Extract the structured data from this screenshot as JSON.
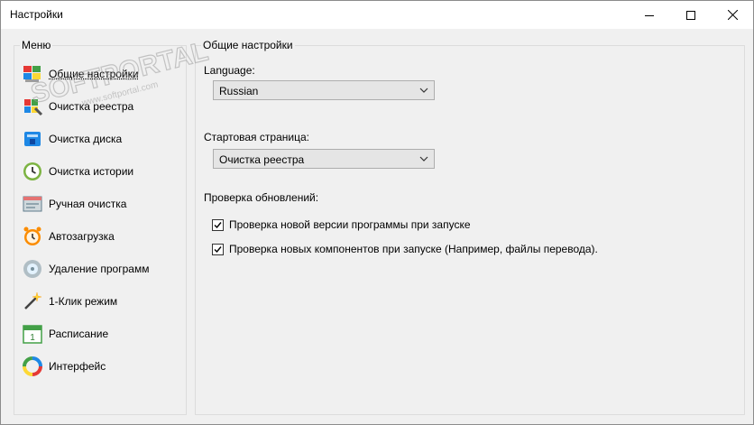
{
  "window": {
    "title": "Настройки",
    "controls": {
      "minimize_icon": "minimize-icon",
      "maximize_icon": "maximize-icon",
      "close_icon": "close-icon"
    }
  },
  "menu": {
    "legend": "Меню",
    "items": [
      {
        "label": "Общие настройки",
        "icon": "general-settings-icon",
        "selected": true
      },
      {
        "label": "Очистка реестра",
        "icon": "registry-cleaner-icon"
      },
      {
        "label": "Очистка диска",
        "icon": "disk-cleaner-icon"
      },
      {
        "label": "Очистка истории",
        "icon": "history-cleaner-icon"
      },
      {
        "label": "Ручная очистка",
        "icon": "manual-cleaning-icon"
      },
      {
        "label": "Автозагрузка",
        "icon": "startup-icon"
      },
      {
        "label": "Удаление программ",
        "icon": "uninstall-icon"
      },
      {
        "label": "1-Клик режим",
        "icon": "one-click-icon"
      },
      {
        "label": "Расписание",
        "icon": "schedule-icon"
      },
      {
        "label": "Интерфейс",
        "icon": "interface-icon"
      }
    ]
  },
  "settings": {
    "legend": "Общие настройки",
    "language_label": "Language:",
    "language_value": "Russian",
    "start_page_label": "Стартовая страница:",
    "start_page_value": "Очистка реестра",
    "updates_label": "Проверка обновлений:",
    "checks": [
      {
        "label": "Проверка новой версии программы при запуске",
        "checked": true
      },
      {
        "label": "Проверка новых компонентов при запуске (Например, файлы перевода).",
        "checked": true
      }
    ]
  },
  "watermark": {
    "text": "SOFTPORTAL",
    "url": "www.softportal.com",
    "tm": "™"
  },
  "colors": {
    "window_bg": "#f0f0f0",
    "titlebar_bg": "#ffffff",
    "combo_bg": "#e5e5e5",
    "border": "#dcdcdc"
  }
}
